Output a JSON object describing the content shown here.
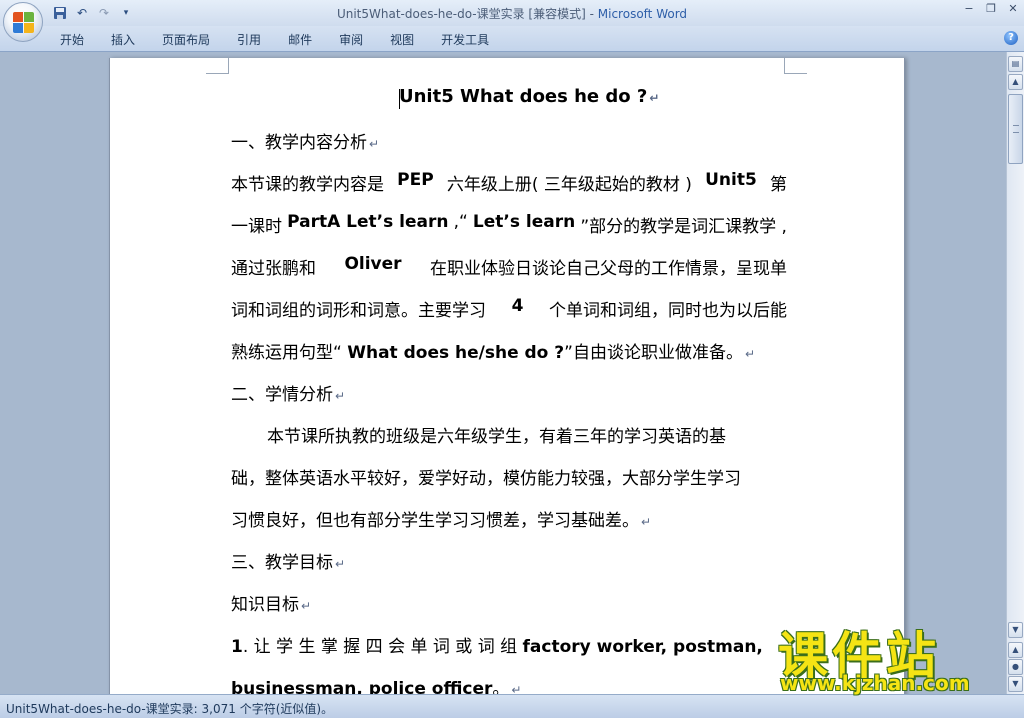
{
  "window": {
    "title_doc": "Unit5What-does-he-do-课堂实录 [兼容模式] - ",
    "title_app": "Microsoft Word",
    "controls": {
      "minimize": "−",
      "restore": "❐",
      "close": "✕"
    }
  },
  "quick_access": {
    "save_icon": "save-icon",
    "undo_icon": "undo-icon",
    "redo_icon": "redo-icon",
    "more_icon": "dropdown-icon"
  },
  "ribbon": {
    "tabs": [
      "开始",
      "插入",
      "页面布局",
      "引用",
      "邮件",
      "审阅",
      "视图",
      "开发工具"
    ],
    "help": "?"
  },
  "document": {
    "title": "Unit5 What does he do ?",
    "s1_heading": "一、教学内容分析",
    "p1": {
      "l1a": "本节课的教学内容是 ",
      "l1b": "PEP",
      "l1c": " 六年级上册( 三年级起始的教材 )",
      "l1d": "Unit5",
      "l1e": " 第",
      "l2a": "一课时 ",
      "l2b": "PartA  Let’s learn",
      "l2c": " ,“",
      "l2d": "Let’s learn",
      "l2e": "”部分的教学是词汇课教学 ,",
      "l3a": "通过张鹏和 ",
      "l3b": "Oliver",
      "l3c": " 在职业体验日谈论自己父母的工作情景，呈现单",
      "l4a": "词和词组的词形和词意。主要学习 ",
      "l4b": "4",
      "l4c": " 个单词和词组，同时也为以后能",
      "l5a": "熟练运用句型“ ",
      "l5b": "What does he/she do ?",
      "l5c": "”自由谈论职业做准备。"
    },
    "s2_heading": "二、学情分析",
    "p2": {
      "l1": "本节课所执教的班级是六年级学生，有着三年的学习英语的基",
      "l2": "础，整体英语水平较好，爱学好动，模仿能力较强，大部分学生学习",
      "l3": "习惯良好，但也有部分学生学习习惯差，学习基础差。"
    },
    "s3_heading": "三、教学目标",
    "sub_heading": "知识目标",
    "p3": {
      "l1a": "1",
      "l1b": ". 让 学 生 掌 握 四 会 单 词 或 词 组 ",
      "l1c": "factory  worker,  postman,",
      "l2a": "businessman, police officer",
      "l2b": "。"
    },
    "paragraph_mark": "↵"
  },
  "status": {
    "text": "Unit5What-does-he-do-课堂实录: 3,071 个字符(近似值)。"
  },
  "watermark": {
    "chars": "课件站",
    "url": "www.kjzhan.com"
  }
}
